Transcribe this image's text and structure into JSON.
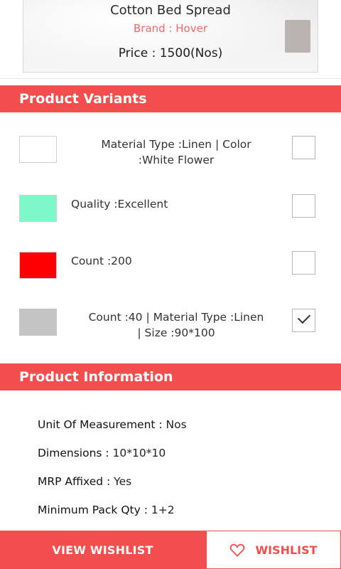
{
  "product": {
    "name": "Cotton Bed Spread",
    "brand": "Brand : Hover",
    "price": "Price : 1500(Nos)"
  },
  "variants_section": {
    "title": "Product Variants",
    "items": [
      {
        "text_line1": "Material Type :Linen | Color",
        "text_line2": ":White Flower",
        "swatch_color": "#ffffff",
        "checked": false
      },
      {
        "text_line1": "Quality :Excellent",
        "text_line2": "",
        "swatch_color": "#7ff8c9",
        "checked": false
      },
      {
        "text_line1": "Count :200",
        "text_line2": "",
        "swatch_color": "#ff0000",
        "checked": false
      },
      {
        "text_line1": "Count :40 | Material Type :Linen",
        "text_line2": "| Size :90*100",
        "swatch_color": "#c4c4c4",
        "checked": true
      }
    ]
  },
  "info_section": {
    "title": "Product Information",
    "rows": [
      {
        "key": "Unit Of Measurement :",
        "value": " Nos"
      },
      {
        "key": "Dimensions :",
        "value": " 10*10*10"
      },
      {
        "key": "MRP Affixed :",
        "value": " Yes"
      },
      {
        "key": "Minimum Pack Qty :",
        "value": " 1+2"
      }
    ]
  },
  "actions": {
    "view_wishlist": "VIEW WISHLIST",
    "wishlist": "WISHLIST",
    "wishlist_icon": "heart-icon"
  },
  "colors": {
    "accent": "#f24e4e",
    "brand_text": "#ef6b6b"
  }
}
